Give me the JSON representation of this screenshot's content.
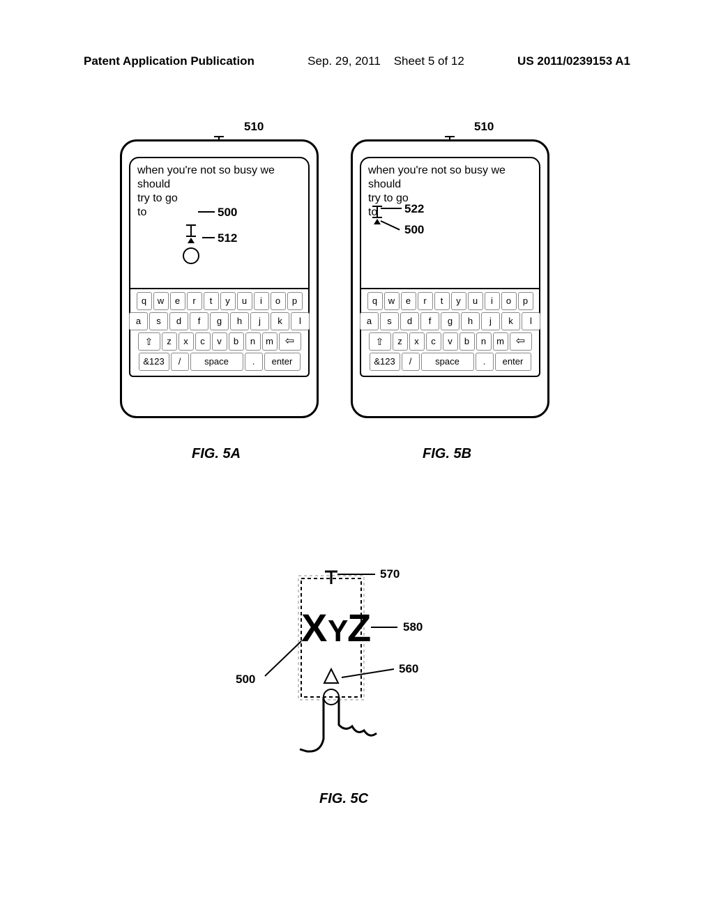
{
  "header": {
    "left": "Patent Application Publication",
    "date": "Sep. 29, 2011",
    "sheet": "Sheet 5 of 12",
    "pubnum": "US 2011/0239153 A1"
  },
  "figures": {
    "a": {
      "label": "FIG. 5A",
      "top_ref": "510",
      "refs": {
        "cursor": "500",
        "touch": "512"
      }
    },
    "b": {
      "label": "FIG. 5B",
      "top_ref": "510",
      "refs": {
        "line": "522",
        "arrow": "500"
      }
    },
    "c": {
      "label": "FIG. 5C",
      "refs": {
        "left": "500",
        "top": "570",
        "mid": "580",
        "low": "560"
      },
      "text": "XYZ"
    }
  },
  "text_area": {
    "line1": "when you're not so busy we",
    "line2": "should",
    "line3": "try to go",
    "line4": "to"
  },
  "keyboard": {
    "row1": [
      "q",
      "w",
      "e",
      "r",
      "t",
      "y",
      "u",
      "i",
      "o",
      "p"
    ],
    "row2": [
      "a",
      "s",
      "d",
      "f",
      "g",
      "h",
      "j",
      "k",
      "l"
    ],
    "row3": [
      "z",
      "x",
      "c",
      "v",
      "b",
      "n",
      "m"
    ],
    "row4": {
      "num": "&123",
      "slash": "/",
      "space": "space",
      "dot": ".",
      "enter": "enter"
    }
  }
}
